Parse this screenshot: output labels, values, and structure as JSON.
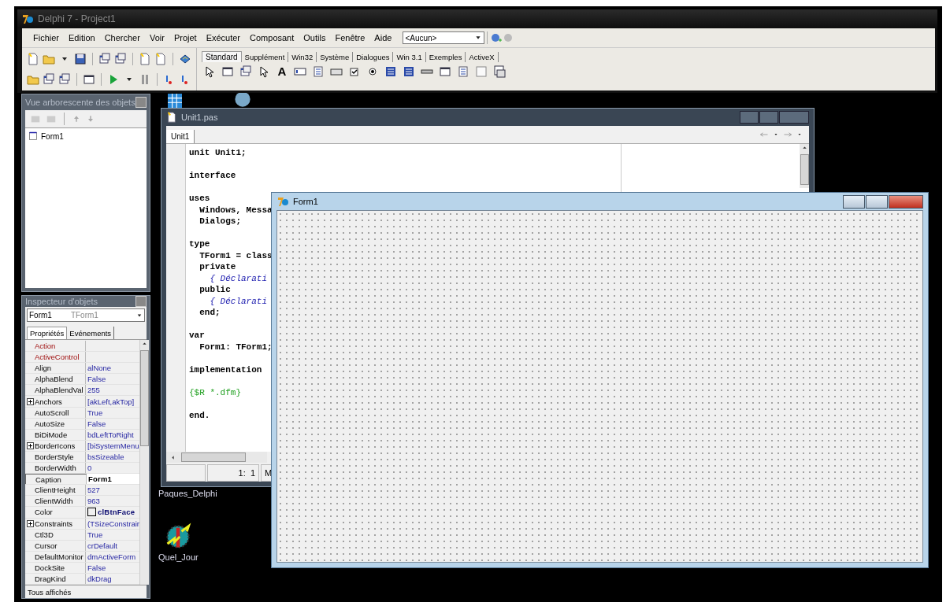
{
  "main_window": {
    "title": "Delphi 7 - Project1"
  },
  "menu": [
    {
      "label": "Fichier"
    },
    {
      "label": "Edition"
    },
    {
      "label": "Chercher"
    },
    {
      "label": "Voir"
    },
    {
      "label": "Projet"
    },
    {
      "label": "Exécuter"
    },
    {
      "label": "Composant"
    },
    {
      "label": "Outils"
    },
    {
      "label": "Fenêtre"
    },
    {
      "label": "Aide"
    }
  ],
  "component_combo": {
    "value": "<Aucun>"
  },
  "palette": {
    "tabs": [
      {
        "label": "Standard",
        "selected": true
      },
      {
        "label": "Supplément",
        "selected": false
      },
      {
        "label": "Win32",
        "selected": false
      },
      {
        "label": "Système",
        "selected": false
      },
      {
        "label": "Dialogues",
        "selected": false
      },
      {
        "label": "Win 3.1",
        "selected": false
      },
      {
        "label": "Exemples",
        "selected": false
      },
      {
        "label": "ActiveX",
        "selected": false
      }
    ],
    "label_tool": "A"
  },
  "object_tree": {
    "title": "Vue arborescente des objets",
    "items": [
      {
        "label": "Form1"
      }
    ]
  },
  "inspector": {
    "title": "Inspecteur d'objets",
    "object": "Form1",
    "class": "TForm1",
    "tabs": [
      {
        "label": "Propriétés",
        "selected": true
      },
      {
        "label": "Evénements",
        "selected": false
      }
    ],
    "properties": [
      {
        "name": "Action",
        "kind": "reference",
        "selected": false
      },
      {
        "name": "ActiveControl",
        "kind": "reference",
        "selected": false
      },
      {
        "name": "Align",
        "value": "alNone",
        "kind": "plain",
        "selected": false,
        "modified": false
      },
      {
        "name": "AlphaBlend",
        "value": "False",
        "kind": "plain",
        "selected": false,
        "modified": false
      },
      {
        "name": "AlphaBlendVal",
        "value": "255",
        "kind": "plain",
        "selected": false,
        "modified": false
      },
      {
        "name": "Anchors",
        "value": "[akLeft,akTop]",
        "kind": "expandable",
        "selected": false,
        "modified": false
      },
      {
        "name": "AutoScroll",
        "value": "True",
        "kind": "plain",
        "selected": false,
        "modified": false
      },
      {
        "name": "AutoSize",
        "value": "False",
        "kind": "plain",
        "selected": false,
        "modified": false
      },
      {
        "name": "BiDiMode",
        "value": "bdLeftToRight",
        "kind": "plain",
        "selected": false,
        "modified": false
      },
      {
        "name": "BorderIcons",
        "value": "[biSystemMenu",
        "kind": "expandable",
        "selected": false,
        "modified": false
      },
      {
        "name": "BorderStyle",
        "value": "bsSizeable",
        "kind": "plain",
        "selected": false,
        "modified": false
      },
      {
        "name": "BorderWidth",
        "value": "0",
        "kind": "plain",
        "selected": false,
        "modified": false
      },
      {
        "name": "Caption",
        "value": "Form1",
        "kind": "plain",
        "selected": true,
        "modified": true
      },
      {
        "name": "ClientHeight",
        "value": "527",
        "kind": "plain",
        "selected": false,
        "modified": false
      },
      {
        "name": "ClientWidth",
        "value": "963",
        "kind": "plain",
        "selected": false,
        "modified": false
      },
      {
        "name": "Color",
        "value": "clBtnFace",
        "kind": "color",
        "selected": false,
        "modified": true
      },
      {
        "name": "Constraints",
        "value": "(TSizeConstrair",
        "kind": "expandable",
        "selected": false,
        "modified": false
      },
      {
        "name": "Ctl3D",
        "value": "True",
        "kind": "plain",
        "selected": false,
        "modified": false
      },
      {
        "name": "Cursor",
        "value": "crDefault",
        "kind": "plain",
        "selected": false,
        "modified": false
      },
      {
        "name": "DefaultMonitor",
        "value": "dmActiveForm",
        "kind": "plain",
        "selected": false,
        "modified": false
      },
      {
        "name": "DockSite",
        "value": "False",
        "kind": "plain",
        "selected": false,
        "modified": false
      },
      {
        "name": "DragKind",
        "value": "dkDrag",
        "kind": "plain",
        "selected": false,
        "modified": false
      }
    ],
    "status": "Tous affichés"
  },
  "editor": {
    "title": "Unit1.pas",
    "tabs": [
      {
        "label": "Unit1",
        "selected": true
      }
    ],
    "blocks": [
      [
        {
          "text": "unit Unit1;",
          "kind": "code"
        }
      ],
      [
        {
          "text": "interface",
          "kind": "code"
        }
      ],
      [
        {
          "text": "uses",
          "kind": "code"
        },
        {
          "text": "  Windows, Messa",
          "kind": "code"
        },
        {
          "text": "  Dialogs;",
          "kind": "code"
        }
      ],
      [
        {
          "text": "type",
          "kind": "code"
        },
        {
          "text": "  TForm1 = class",
          "kind": "code"
        },
        {
          "text": "  private",
          "kind": "code"
        },
        {
          "text": "    { Déclarati",
          "kind": "comment"
        },
        {
          "text": "  public",
          "kind": "code"
        },
        {
          "text": "    { Déclarati",
          "kind": "comment"
        },
        {
          "text": "  end;",
          "kind": "code"
        }
      ],
      [
        {
          "text": "var",
          "kind": "code"
        },
        {
          "text": "  Form1: TForm1;",
          "kind": "code"
        }
      ],
      [
        {
          "text": "implementation",
          "kind": "code"
        }
      ],
      [
        {
          "text": "{$R *.dfm}",
          "kind": "directive"
        }
      ],
      [
        {
          "text": "end.",
          "kind": "code"
        }
      ]
    ],
    "status": {
      "position": "1:  1",
      "mode": "M"
    }
  },
  "form_window": {
    "title": "Form1"
  },
  "desktop_icons": [
    {
      "label": "Paques_Delphi"
    },
    {
      "label": "Quel_Jour"
    }
  ]
}
